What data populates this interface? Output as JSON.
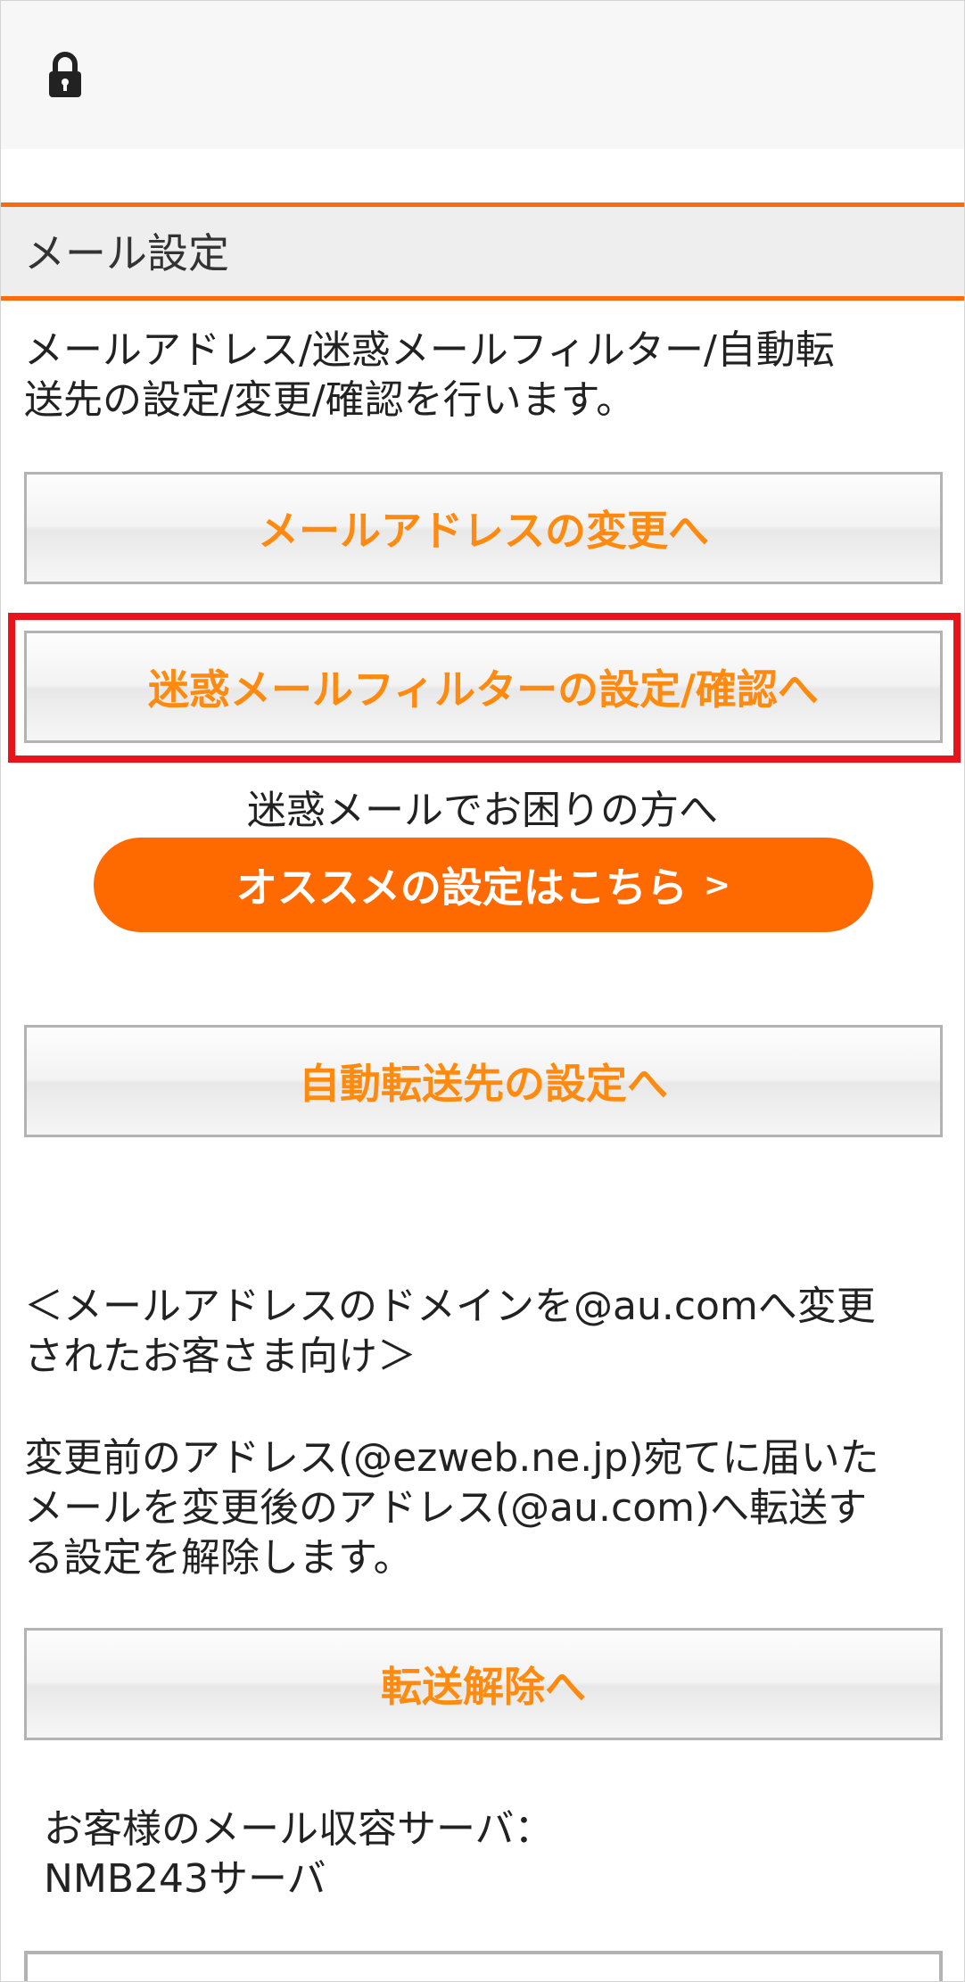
{
  "header": {
    "lock_icon": "lock-icon"
  },
  "section": {
    "title": "メール設定",
    "description_lines": [
      "メールアドレス/迷惑メールフィルター/自動転",
      "送先の設定/変更/確認を行います。"
    ]
  },
  "buttons": {
    "change_address": "メールアドレスの変更へ",
    "spam_filter": "迷惑メールフィルターの設定/確認へ",
    "auto_forward": "自動転送先の設定へ",
    "forward_cancel": "転送解除へ"
  },
  "recommend": {
    "prompt": "迷惑メールでお困りの方へ",
    "button_label": "オススメの設定はこちら",
    "chevron": ">"
  },
  "domain_notice": {
    "heading_lines": [
      "＜メールアドレスのドメインを@au.comへ変更",
      "されたお客さま向け＞"
    ],
    "body_lines": [
      "変更前のアドレス(@ezweb.ne.jp)宛てに届いた",
      "メールを変更後のアドレス(@au.com)へ転送す",
      "る設定を解除します。"
    ]
  },
  "server": {
    "label": "お客様のメール収容サーバ：",
    "value": "NMB243サーバ"
  },
  "colors": {
    "accent": "#ff6a00",
    "button_text": "#ff8a10",
    "highlight": "#e8141a"
  }
}
